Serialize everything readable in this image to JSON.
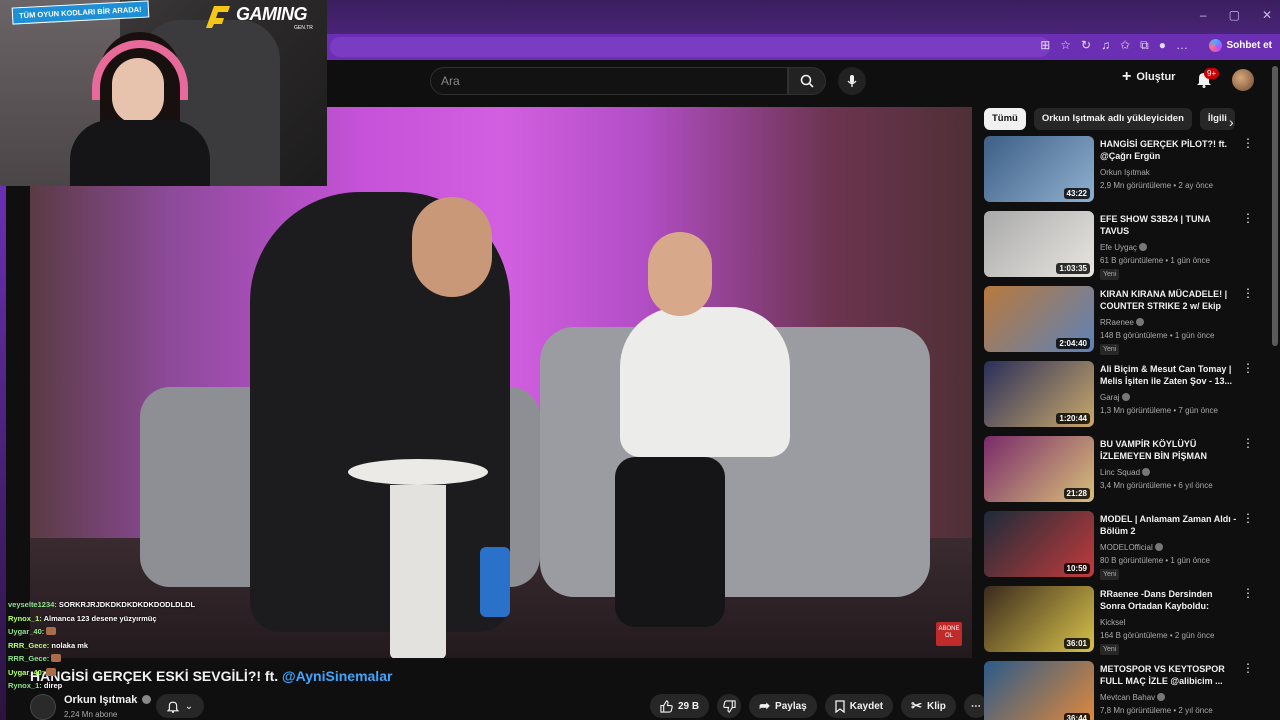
{
  "browser": {
    "chat_button": "Sohbet et",
    "window_controls": [
      "–",
      "▢",
      "✕"
    ]
  },
  "youtube": {
    "search_placeholder": "Ara",
    "create_label": "Oluştur",
    "notification_count": "9+"
  },
  "video": {
    "title_prefix": "HANGİSİ GERÇEK ESKİ SEVGİLİ?! ft. ",
    "title_mention": "@AyniSinemalar",
    "channel_name": "Orkun Işıtmak",
    "subscribers": "2,24 Mn abone",
    "likes": "29 B",
    "share": "Paylaş",
    "save": "Kaydet",
    "clip": "Klip",
    "subscribe_overlay": "ABONE OL"
  },
  "chips": [
    "Tümü",
    "Orkun Işıtmak adlı yükleyiciden",
    "İlgili"
  ],
  "recommendations": [
    {
      "title": "HANGİSİ GERÇEK PİLOT?! ft. @Çağrı Ergün",
      "channel": "Orkun Işıtmak",
      "verified": false,
      "meta": "2,9 Mn görüntüleme • 2 ay önce",
      "duration": "43:22",
      "new": "",
      "color1": "#3e5f86",
      "color2": "#8fb0cf"
    },
    {
      "title": "EFE SHOW S3B24 | TUNA TAVUS",
      "channel": "Efe Uygaç",
      "verified": true,
      "meta": "61 B görüntüleme • 1 gün önce",
      "duration": "1:03:35",
      "new": "Yeni",
      "color1": "#a9a9aa",
      "color2": "#e8e6e0"
    },
    {
      "title": "KIRAN KIRANA MÜCADELE! | COUNTER STRIKE 2 w/ Ekip",
      "channel": "RRaenee",
      "verified": true,
      "meta": "148 B görüntüleme • 1 gün önce",
      "duration": "2:04:40",
      "new": "Yeni",
      "color1": "#b9793c",
      "color2": "#5e82b8"
    },
    {
      "title": "Ali Biçim & Mesut Can Tomay | Melis İşiten ile Zaten Şov - 13...",
      "channel": "Garaj",
      "verified": true,
      "meta": "1,3 Mn görüntüleme • 7 gün önce",
      "duration": "1:20:44",
      "new": "",
      "color1": "#2a2f5a",
      "color2": "#c9a86a"
    },
    {
      "title": "BU VAMPİR KÖYLÜYÜ İZLEMEYEN BİN PİŞMAN",
      "channel": "Linc Squad",
      "verified": true,
      "meta": "3,4 Mn görüntüleme • 6 yıl önce",
      "duration": "21:28",
      "new": "",
      "color1": "#7a2a6a",
      "color2": "#d8c07a"
    },
    {
      "title": "MODEL | Anlamam Zaman Aldı - Bölüm 2",
      "channel": "MODELOfficial",
      "verified": true,
      "meta": "80 B görüntüleme • 1 gün önce",
      "duration": "10:59",
      "new": "Yeni",
      "color1": "#1c2b3a",
      "color2": "#c23b3b"
    },
    {
      "title": "RRaenee -Dans Dersinden Sonra Ortadan Kayboldu: Rach...",
      "channel": "Kicksel",
      "verified": false,
      "meta": "164 B görüntüleme • 2 gün önce",
      "duration": "36:01",
      "new": "Yeni",
      "color1": "#3a2a1e",
      "color2": "#d9c34a"
    },
    {
      "title": "METOSPOR VS KEYTOSPOR FULL MAÇ İZLE @alibicim ...",
      "channel": "Mevtcan Bahav",
      "verified": true,
      "meta": "7,8 Mn görüntüleme • 2 yıl önce",
      "duration": "36:44",
      "new": "",
      "color1": "#2b5a8a",
      "color2": "#e48a3a"
    }
  ],
  "overlay": {
    "promo": "TÜM OYUN KODLARI BİR ARADA!",
    "logo": "GAMING",
    "logo_sub": "GEN.TR"
  },
  "chat": [
    {
      "user": "veyselte1234:",
      "msg": "SORKRJRJDKDKDKDKDKDODLDLDL"
    },
    {
      "user": "Rynox_1:",
      "msg": "Almanca 123 desene yüzyırmüç"
    },
    {
      "user": "Uygar_40:",
      "msg": ""
    },
    {
      "user": "RRR_Gece:",
      "msg": "nolaka mk"
    },
    {
      "user": "RRR_Gece:",
      "msg": ""
    },
    {
      "user": "Uygar_40:",
      "msg": ""
    },
    {
      "user": "Rynox_1:",
      "msg": "direp"
    }
  ]
}
